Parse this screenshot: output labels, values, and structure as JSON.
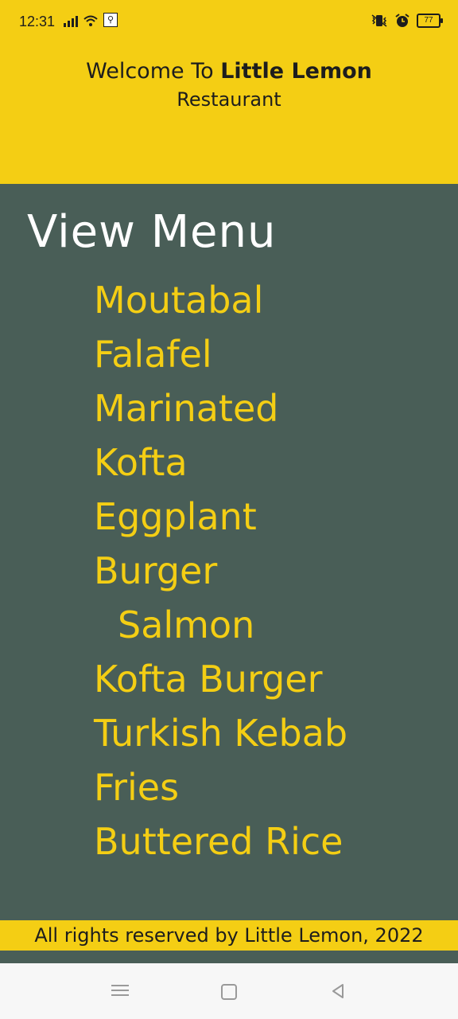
{
  "status_bar": {
    "time": "12:31",
    "battery": "77",
    "icons": [
      "signal-icon",
      "wifi-icon",
      "usb-icon",
      "vibrate-icon",
      "alarm-icon",
      "battery-icon"
    ]
  },
  "header": {
    "welcome_prefix": "Welcome To",
    "brand": "Little Lemon",
    "subtitle": "Restaurant"
  },
  "menu": {
    "title": "View Menu",
    "items": [
      "Moutabal",
      "Falafel",
      "Marinated",
      "Kofta",
      "Eggplant",
      "Burger",
      "Salmon",
      "Kofta Burger",
      "Turkish Kebab",
      "Fries",
      "Buttered Rice"
    ]
  },
  "footer": {
    "text": "All rights reserved by Little Lemon, 2022"
  },
  "nav_bar": {
    "buttons": [
      "menu-icon",
      "home-icon",
      "back-icon"
    ]
  },
  "colors": {
    "yellow": "#f4ce14",
    "green": "#495e57",
    "white": "#ffffff"
  }
}
